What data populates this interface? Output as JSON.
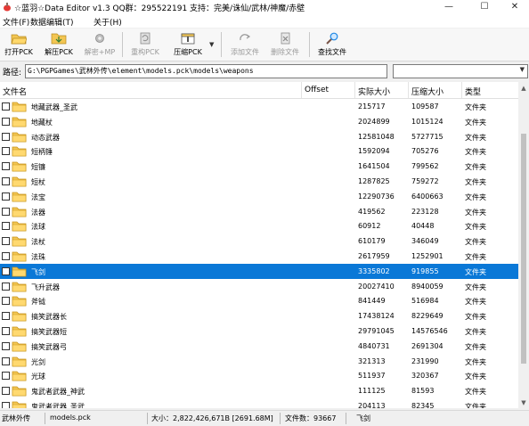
{
  "window": {
    "title": "☆蓝羽☆Data Editor v1.3  QQ群：295522191 支持：完美/诛仙/武林/神魔/赤壁",
    "controls": {
      "minimize": "—",
      "maximize": "☐",
      "close": "✕"
    }
  },
  "menu": {
    "items": [
      "文件(F)",
      "数据编辑(T)",
      "关于(H)"
    ]
  },
  "toolbar": {
    "buttons": [
      {
        "label": "打开PCK",
        "icon": "open-folder-icon",
        "enabled": true
      },
      {
        "label": "解压PCK",
        "icon": "extract-folder-icon",
        "enabled": true
      },
      {
        "label": "解密+MP",
        "icon": "decrypt-gear-icon",
        "enabled": false
      },
      {
        "label": "重构PCK",
        "icon": "rebuild-icon",
        "enabled": false
      },
      {
        "label": "压缩PCK",
        "icon": "compress-icon",
        "enabled": true
      },
      {
        "label": "添加文件",
        "icon": "add-file-icon",
        "enabled": false
      },
      {
        "label": "删除文件",
        "icon": "delete-file-icon",
        "enabled": false
      },
      {
        "label": "查找文件",
        "icon": "search-icon",
        "enabled": true
      }
    ]
  },
  "path": {
    "label": "路径:",
    "value": "G:\\PGPGames\\武林外传\\element\\models.pck\\models\\weapons",
    "combo_value": ""
  },
  "list": {
    "columns": [
      "文件名",
      "Offset",
      "实际大小",
      "压缩大小",
      "类型"
    ],
    "rows": [
      {
        "name": "地藏武器_圣武",
        "offset": "",
        "real": "215717",
        "comp": "109587",
        "type": "文件夹",
        "selected": false
      },
      {
        "name": "地藏杖",
        "offset": "",
        "real": "2024899",
        "comp": "1015124",
        "type": "文件夹",
        "selected": false
      },
      {
        "name": "动态武器",
        "offset": "",
        "real": "12581048",
        "comp": "5727715",
        "type": "文件夹",
        "selected": false
      },
      {
        "name": "短柄锤",
        "offset": "",
        "real": "1592094",
        "comp": "705276",
        "type": "文件夹",
        "selected": false
      },
      {
        "name": "短镰",
        "offset": "",
        "real": "1641504",
        "comp": "799562",
        "type": "文件夹",
        "selected": false
      },
      {
        "name": "短杖",
        "offset": "",
        "real": "1287825",
        "comp": "759272",
        "type": "文件夹",
        "selected": false
      },
      {
        "name": "法宝",
        "offset": "",
        "real": "12290736",
        "comp": "6400663",
        "type": "文件夹",
        "selected": false
      },
      {
        "name": "法器",
        "offset": "",
        "real": "419562",
        "comp": "223128",
        "type": "文件夹",
        "selected": false
      },
      {
        "name": "法球",
        "offset": "",
        "real": "60912",
        "comp": "40448",
        "type": "文件夹",
        "selected": false
      },
      {
        "name": "法杖",
        "offset": "",
        "real": "610179",
        "comp": "346049",
        "type": "文件夹",
        "selected": false
      },
      {
        "name": "法珠",
        "offset": "",
        "real": "2617959",
        "comp": "1252901",
        "type": "文件夹",
        "selected": false
      },
      {
        "name": "飞剑",
        "offset": "",
        "real": "3335802",
        "comp": "919855",
        "type": "文件夹",
        "selected": true
      },
      {
        "name": "飞升武器",
        "offset": "",
        "real": "20027410",
        "comp": "8940059",
        "type": "文件夹",
        "selected": false
      },
      {
        "name": "斧钺",
        "offset": "",
        "real": "841449",
        "comp": "516984",
        "type": "文件夹",
        "selected": false
      },
      {
        "name": "搞笑武器长",
        "offset": "",
        "real": "17438124",
        "comp": "8229649",
        "type": "文件夹",
        "selected": false
      },
      {
        "name": "搞笑武器短",
        "offset": "",
        "real": "29791045",
        "comp": "14576546",
        "type": "文件夹",
        "selected": false
      },
      {
        "name": "搞笑武器弓",
        "offset": "",
        "real": "4840731",
        "comp": "2691304",
        "type": "文件夹",
        "selected": false
      },
      {
        "name": "光剑",
        "offset": "",
        "real": "321313",
        "comp": "231990",
        "type": "文件夹",
        "selected": false
      },
      {
        "name": "光球",
        "offset": "",
        "real": "511937",
        "comp": "320367",
        "type": "文件夹",
        "selected": false
      },
      {
        "name": "鬼武者武器_神武",
        "offset": "",
        "real": "111125",
        "comp": "81593",
        "type": "文件夹",
        "selected": false
      },
      {
        "name": "鬼武者武器_圣武",
        "offset": "",
        "real": "204113",
        "comp": "82345",
        "type": "文件夹",
        "selected": false
      }
    ]
  },
  "status": {
    "game": "武林外传",
    "file": "models.pck",
    "size": "大小：2,822,426,671B [2691.68M]",
    "count": "文件数：93667",
    "selected": "飞剑"
  },
  "colors": {
    "selection": "#0a78d7",
    "folder": "#f3c653",
    "background": "#f0f0f0"
  }
}
